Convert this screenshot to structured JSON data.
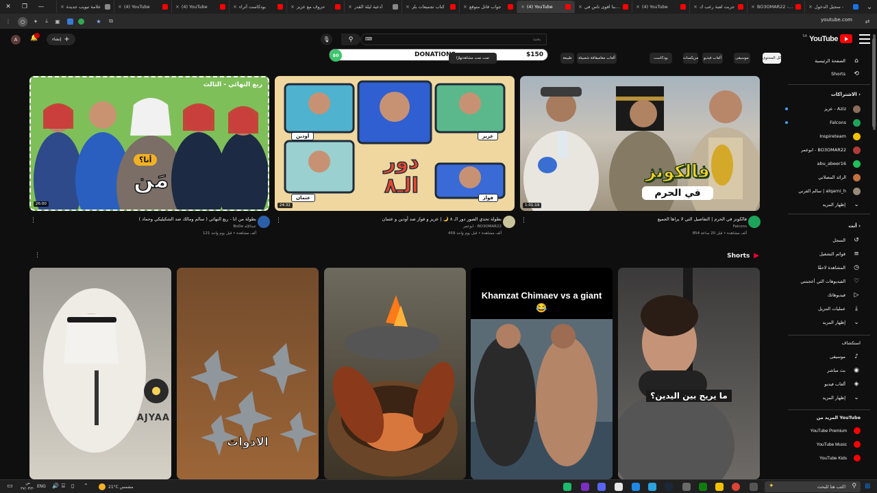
{
  "browser": {
    "tabs": [
      {
        "label": "سجيل الدخول -",
        "fav": "#1a73e8"
      },
      {
        "label": "BO3OMAR22 - بر",
        "fav": "#ff0000"
      },
      {
        "label": "جربت لعبة رعب ك",
        "fav": "#ff0000"
      },
      {
        "label": "(4) YouTube",
        "fav": "#ff0000"
      },
      {
        "label": "جربنا اقوى ناس في",
        "fav": "#ff0000"
      },
      {
        "label": "(4) YouTube",
        "fav": "#ff0000",
        "active": true
      },
      {
        "label": "جواب قاتل متوقع",
        "fav": "#ff0000"
      },
      {
        "label": "كتاب تجميعات بلز",
        "fav": "#ff0000"
      },
      {
        "label": "أدعية ليلة القدر",
        "fav": "#888888"
      },
      {
        "label": "حروف مع عزيز",
        "fav": "#ff0000"
      },
      {
        "label": "بودكاست أثراء",
        "fav": "#ff0000"
      },
      {
        "label": "(4) YouTube",
        "fav": "#ff0000"
      },
      {
        "label": "(4) YouTube",
        "fav": "#ff0000"
      },
      {
        "label": "علامة تبويب جديدة",
        "fav": "#888888"
      }
    ],
    "url": "youtube.com"
  },
  "masthead": {
    "logo": "YouTube",
    "logo_sup": "SA",
    "search_placeholder": "بحث",
    "create_label": "إنشاء",
    "avatar_letter": "A"
  },
  "overlay": {
    "donations_label": "DONATIONS",
    "amount_left": "$0",
    "amount_right": "$150"
  },
  "chips": [
    {
      "label": "كل المحتوى",
      "selected": true
    },
    {
      "label": "موسيقى"
    },
    {
      "label": "ألعاب فيديو"
    },
    {
      "label": "مزيكسات"
    },
    {
      "label": "بودكاست"
    },
    {
      "label": "ألعاب مغامرات ومحركة"
    },
    {
      "label": "ثقافة شعبية"
    },
    {
      "label": "طبيعة"
    },
    {
      "label": "تمت مشاهدتها مؤخرًا"
    },
    {
      "label": "تمت مشاهدتها"
    }
  ],
  "sidebar": {
    "home": "الصفحة الرئيسية",
    "shorts": "Shorts",
    "subscriptions_heading": "الاشتراكات",
    "subscriptions": [
      {
        "label": "عزيز - Aziz",
        "color": "#8a6d5a",
        "dot": true
      },
      {
        "label": "Falcons",
        "color": "#1ea35b",
        "dot": true
      },
      {
        "label": "Inspireteam",
        "color": "#f2c200"
      },
      {
        "label": "ابوعمر - BO3OMAR22",
        "color": "#b33a3a"
      },
      {
        "label": "abu_abeer16",
        "color": "#20c05b"
      },
      {
        "label": "الرائد المصلاني",
        "color": "#c2723f"
      },
      {
        "label": "سالم القرني | alqarni_h",
        "color": "#9a8a7a"
      },
      {
        "label": "إظهار المزيد"
      }
    ],
    "you_heading": "أنت",
    "you": [
      {
        "label": "السجل",
        "icon": "↺"
      },
      {
        "label": "قوائم التشغيل",
        "icon": "≡"
      },
      {
        "label": "المشاهدة لاحقًا",
        "icon": "◷"
      },
      {
        "label": "الفيديوهات التي أعجبتني",
        "icon": "♡"
      },
      {
        "label": "فيديوهاتك",
        "icon": "▷"
      },
      {
        "label": "عمليات التنزيل",
        "icon": "⤓"
      },
      {
        "label": "إظهار المزيد",
        "icon": "⌄"
      }
    ],
    "explore_heading": "استكشاف",
    "explore": [
      {
        "label": "موسيقى",
        "icon": "♪"
      },
      {
        "label": "بث مباشر",
        "icon": "◉"
      },
      {
        "label": "ألعاب فيديو",
        "icon": "◈"
      },
      {
        "label": "إظهار المزيد",
        "icon": "⌄"
      }
    ],
    "more_heading": "المزيد من YouTube",
    "more": [
      {
        "label": "YouTube Premium",
        "color": "#ff0000"
      },
      {
        "label": "YouTube Music",
        "color": "#ff0000"
      },
      {
        "label": "YouTube Kids",
        "color": "#ff0000"
      }
    ]
  },
  "videos": [
    {
      "title": "فالكونز في الحرم | التفاصيل التي لا يراها الجميع",
      "channel": "Falcons",
      "views": "854 ألف مشاهدة",
      "age": "قبل 20 ساعة",
      "duration": "1:01:19",
      "overlay_text": "فالكونز",
      "overlay_text2": "في الحرم"
    },
    {
      "title": "بطولة تحدي الصور دور الـ ٨ 🌙 | عزيز و فواز ضد أودين و عثمان",
      "channel": "ابوعمر - BO3OMAR22",
      "views": "459 ألف مشاهدة",
      "age": "قبل يوم واحد",
      "duration": "24:32",
      "overlay_text": "دور الـ٨",
      "names": [
        "أودين",
        "عزيز",
        "عثمان",
        "فواز"
      ]
    },
    {
      "title": "بطولة من انا - ربع النهائي ( سالم ومالك ضد الشكيليكي وحماد )",
      "channel": "BoDe عبدالإله",
      "views": "121 ألف مشاهدة",
      "age": "قبل يوم واحد",
      "duration": "26:00",
      "overlay_text": "مَن",
      "overlay_text2": "أنا؟",
      "overlay_text3": "ربع النهائي - الثالث"
    }
  ],
  "shorts_heading": "Shorts",
  "shorts": [
    {
      "caption": "ما يريح بين اليدين؟"
    },
    {
      "caption": "Khamzat Chimaev vs a giant 😂"
    },
    {
      "caption": ""
    },
    {
      "caption": "الادوات"
    },
    {
      "caption": "AJYAA"
    }
  ],
  "taskbar": {
    "search_placeholder": "اكتب هنا للبحث",
    "weather": "21°C مشمس",
    "lang": "ENG",
    "time": "ص",
    "date": "٢٧/٠٣/٢٠"
  }
}
